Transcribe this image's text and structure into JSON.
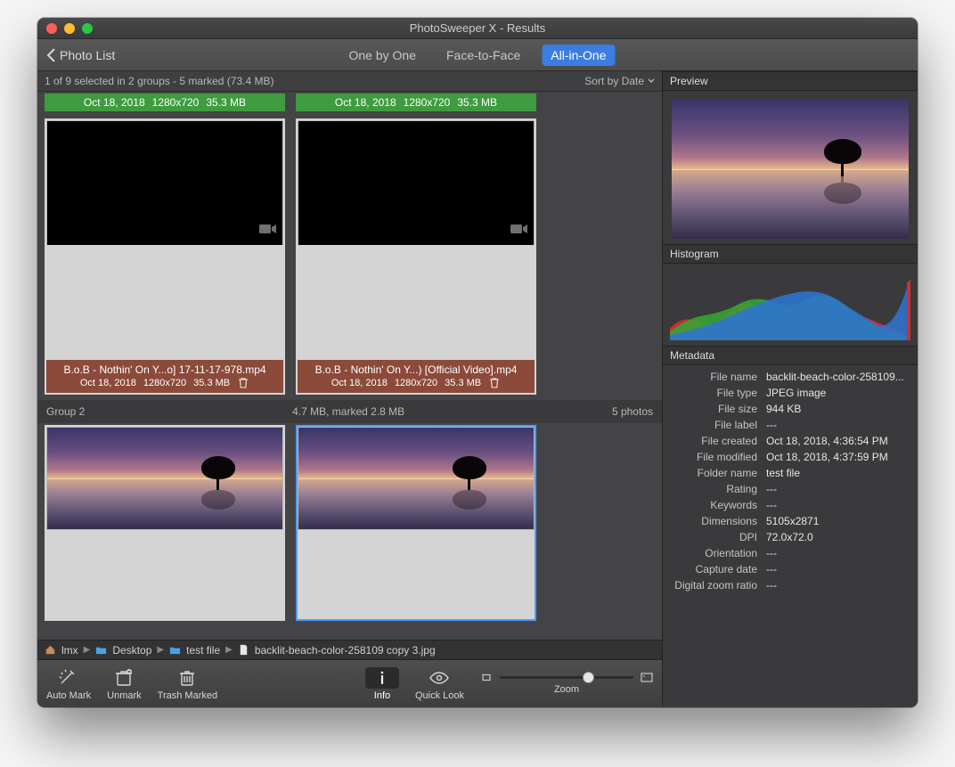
{
  "window": {
    "title": "PhotoSweeper X - Results"
  },
  "toolbar": {
    "back_label": "Photo List",
    "segments": {
      "one": "One by One",
      "face": "Face-to-Face",
      "all": "All-in-One"
    }
  },
  "strip": {
    "status": "1 of 9 selected in 2 groups - 5 marked (73.4 MB)",
    "sort": "Sort by Date"
  },
  "group1": {
    "caps": {
      "a_date": "Oct 18, 2018",
      "a_dims": "1280x720",
      "a_size": "35.3 MB",
      "b_date": "Oct 18, 2018",
      "b_dims": "1280x720",
      "b_size": "35.3 MB"
    },
    "marked": {
      "a_name": "B.o.B - Nothin' On Y...o] 17-11-17-978.mp4",
      "a_date": "Oct 18, 2018",
      "a_dims": "1280x720",
      "a_size": "35.3 MB",
      "b_name": "B.o.B - Nothin' On Y...) [Official Video].mp4",
      "b_date": "Oct 18, 2018",
      "b_dims": "1280x720",
      "b_size": "35.3 MB"
    }
  },
  "group2": {
    "label": "Group 2",
    "center": "4.7 MB, marked 2.8 MB",
    "right": "5 photos"
  },
  "pathbar": {
    "p0": "lmx",
    "p1": "Desktop",
    "p2": "test file",
    "p3": "backlit-beach-color-258109 copy 3.jpg"
  },
  "bottom": {
    "automark": "Auto Mark",
    "unmark": "Unmark",
    "trash": "Trash Marked",
    "info": "Info",
    "quicklook": "Quick Look",
    "zoom": "Zoom"
  },
  "side": {
    "preview": "Preview",
    "histogram": "Histogram",
    "metadata": "Metadata"
  },
  "metadata": {
    "rows": [
      {
        "k": "File name",
        "v": "backlit-beach-color-258109..."
      },
      {
        "k": "File type",
        "v": "JPEG image"
      },
      {
        "k": "File size",
        "v": "944 KB"
      },
      {
        "k": "File label",
        "v": "---"
      },
      {
        "k": "File created",
        "v": "Oct 18, 2018, 4:36:54 PM"
      },
      {
        "k": "File modified",
        "v": "Oct 18, 2018, 4:37:59 PM"
      },
      {
        "k": "Folder name",
        "v": "test file"
      },
      {
        "k": "Rating",
        "v": "---"
      },
      {
        "k": "Keywords",
        "v": "---"
      },
      {
        "k": "Dimensions",
        "v": "5105x2871"
      },
      {
        "k": "DPI",
        "v": "72.0x72.0"
      },
      {
        "k": "Orientation",
        "v": "---"
      },
      {
        "k": "Capture date",
        "v": "---"
      },
      {
        "k": "Digital zoom ratio",
        "v": "---"
      }
    ]
  }
}
